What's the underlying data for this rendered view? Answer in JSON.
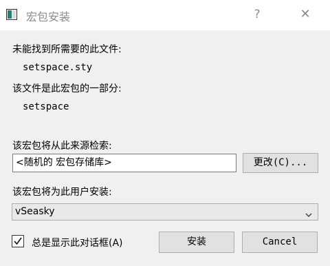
{
  "window": {
    "title": "宏包安装",
    "help_symbol": "?",
    "close_symbol": "✕",
    "icon": "window-app-icon"
  },
  "message": {
    "missing_file_label": "未能找到所需要的此文件:",
    "missing_file_name": "setspace.sty",
    "part_of_package_label": "该文件是此宏包的一部分:",
    "package_name": "setspace"
  },
  "source": {
    "label": "该宏包将从此来源检索:",
    "value": "<随机的 宏包存储库>",
    "change_button": "更改(C)..."
  },
  "install_for": {
    "label": "该宏包将为此用户安装:",
    "selected": "vSeasky"
  },
  "footer": {
    "always_show_label": "总是显示此对话框(A)",
    "always_show_checked": true,
    "install_button": "安装",
    "cancel_button": "Cancel"
  }
}
